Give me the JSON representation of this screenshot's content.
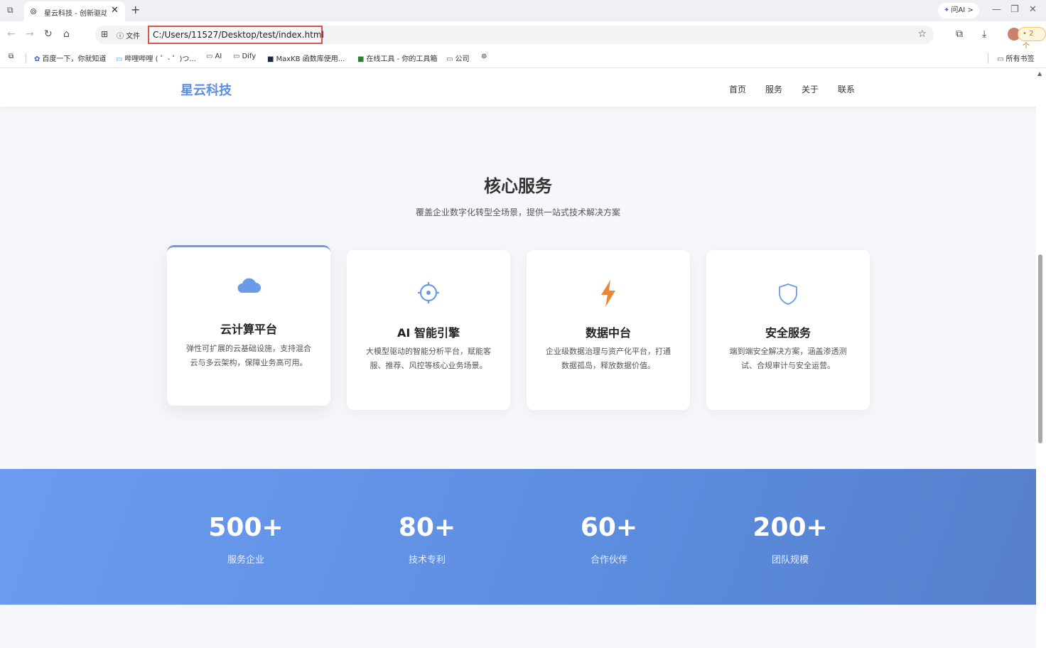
{
  "browser": {
    "tab_title": "星云科技 - 创新驱动",
    "new_tab": "+",
    "ai_button": "问AI >",
    "url_label": "文件",
    "url": "C:/Users/11527/Desktop/test/index.html",
    "profile_badge": "• 2 个",
    "bookmarks": [
      "百度一下，你就知道",
      "哔哩哔哩 ( ゜- ゜)つ...",
      "AI",
      "Dify",
      "MaxKB 函数库使用...",
      "在线工具 - 你的工具箱",
      "公司"
    ],
    "all_bookmarks": "所有书签"
  },
  "site": {
    "logo": "星云科技",
    "nav": [
      "首页",
      "服务",
      "关于",
      "联系"
    ]
  },
  "services": {
    "title": "核心服务",
    "subtitle": "覆盖企业数字化转型全场景，提供一站式技术解决方案",
    "cards": [
      {
        "icon": "cloud-icon",
        "title": "云计算平台",
        "desc": "弹性可扩展的云基础设施，支持混合云与多云架构，保障业务高可用。"
      },
      {
        "icon": "gear-icon",
        "title": "AI 智能引擎",
        "desc": "大模型驱动的智能分析平台，赋能客服、推荐、风控等核心业务场景。"
      },
      {
        "icon": "lightning-icon",
        "title": "数据中台",
        "desc": "企业级数据治理与资产化平台，打通数据孤岛，释放数据价值。"
      },
      {
        "icon": "shield-icon",
        "title": "安全服务",
        "desc": "端到端安全解决方案，涵盖渗透测试、合规审计与安全运营。"
      }
    ]
  },
  "stats": [
    {
      "value": "500+",
      "label": "服务企业"
    },
    {
      "value": "80+",
      "label": "技术专利"
    },
    {
      "value": "60+",
      "label": "合作伙伴"
    },
    {
      "value": "200+",
      "label": "团队规模"
    }
  ],
  "colors": {
    "brand": "#5b8ee6",
    "lightning": "#e8873a",
    "stats_bg": "#6c9cf0"
  }
}
